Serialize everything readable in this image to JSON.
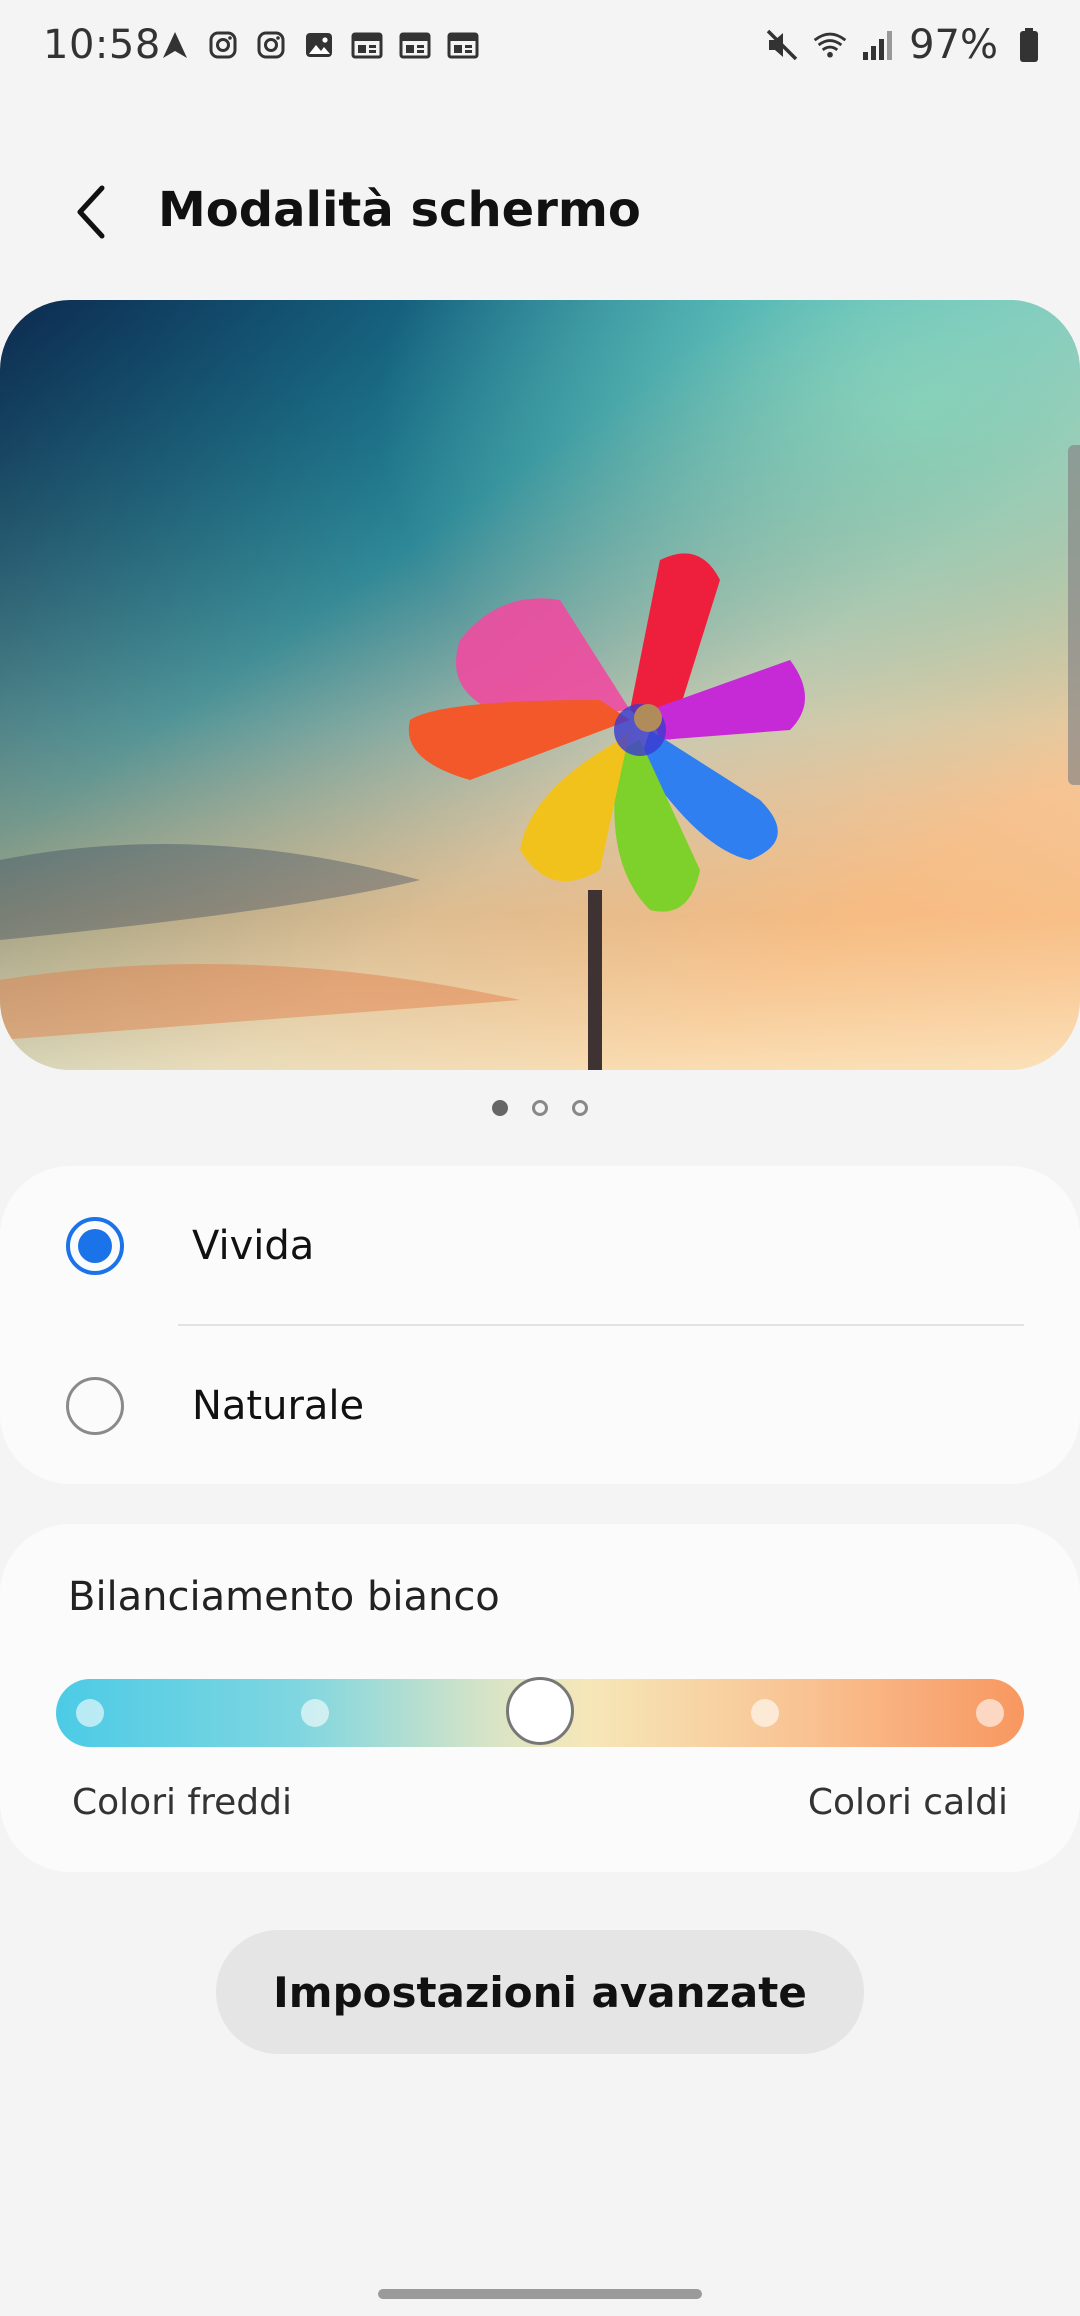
{
  "status_bar": {
    "time": "10:58",
    "left_icons": [
      "navigation-icon",
      "instagram-icon",
      "instagram-icon",
      "gallery-icon",
      "calendar-icon",
      "calendar-icon",
      "calendar-icon"
    ],
    "right_icons": [
      "mute-icon",
      "wifi-icon",
      "signal-icon"
    ],
    "battery_percent": "97%",
    "battery_level": 0.97
  },
  "header": {
    "title": "Modalità schermo"
  },
  "preview": {
    "page_count": 3,
    "active_page": 0
  },
  "screen_mode": {
    "options": [
      {
        "label": "Vivida",
        "selected": true
      },
      {
        "label": "Naturale",
        "selected": false
      }
    ]
  },
  "white_balance": {
    "title": "Bilanciamento bianco",
    "left_label": "Colori freddi",
    "right_label": "Colori caldi",
    "steps": 5,
    "value_index": 2
  },
  "advanced_button": {
    "label": "Impostazioni avanzate"
  },
  "colors": {
    "accent": "#1a73e8",
    "background": "#f4f4f4",
    "card": "#fbfbfb"
  }
}
